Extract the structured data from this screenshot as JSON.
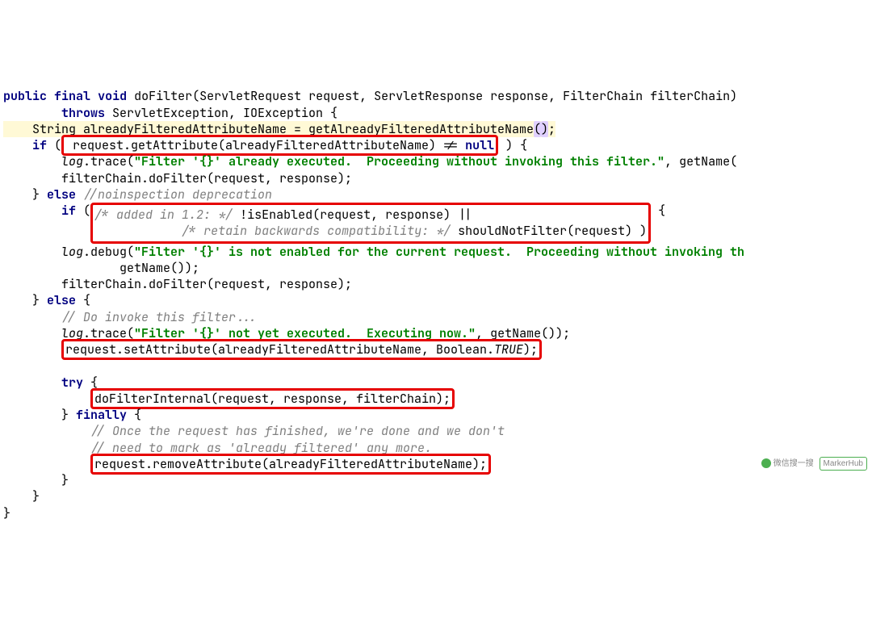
{
  "code": {
    "l01a": "public",
    "l01b": "final",
    "l01c": "void",
    "l01_sig": " doFilter(ServletRequest request, ServletResponse response, FilterChain filterChain)",
    "l02a": "throws",
    "l02_rest": " ServletException, IOException {",
    "l03_hl": "    String alreadyFilteredAttributeName = getAlreadyFilteredAttributeName",
    "l03_paren1": "(",
    "l03_paren2": ")",
    "l03_semi": ";",
    "l04_if": "if",
    "l04_pre": " (",
    "l04_box": " request.getAttribute(alreadyFilteredAttributeName) != ",
    "l04_null": "null",
    "l04_post": " ) {",
    "l05_ital": "log",
    "l05_mid": ".trace(",
    "l05_str": "\"Filter '{}' already executed.  Proceeding without invoking this filter.\"",
    "l05_end": ", getName(",
    "l06": "        filterChain.doFilter(request, response);",
    "l07_brace": "    } ",
    "l07_else": "else",
    "l07_sp": " ",
    "l07_comm": "//noinspection deprecation",
    "l08_if": "if",
    "l08_pre": " (",
    "l08_comm1": "/* added in 1.2: */",
    "l08_mid": " !isEnabled(request, response) ||",
    "l09_comm": "/* retain backwards compatibility: */",
    "l09_mid": " shouldNotFilter(request) )",
    "l09_post": " {",
    "l10_log": "log",
    "l10_mid": ".debug(",
    "l10_str": "\"Filter '{}' is not enabled for the current request.  Proceeding without invoking th",
    "l11_a": "                getName());",
    "l12": "        filterChain.doFilter(request, response);",
    "l13_brace": "    } ",
    "l13_else": "else",
    "l13_post": " {",
    "l14_comm": "// Do invoke this filter...",
    "l15_log": "log",
    "l15_mid": ".trace(",
    "l15_str": "\"Filter '{}' not yet executed.  Executing now.\"",
    "l15_end": ", getName());",
    "l16_box": "request.setAttribute(alreadyFilteredAttributeName, Boolean.",
    "l16_true": "TRUE",
    "l16_end": ");",
    "l17_try": "try",
    "l17_post": " {",
    "l18_box": "doFilterInternal(request, response, filterChain);",
    "l19_brace": "        } ",
    "l19_fin": "finally",
    "l19_post": " {",
    "l20_comm": "// Once the request has finished, we're done and we don't",
    "l21_comm": "// need to mark as 'already filtered' any more.",
    "l22_box": "request.removeAttribute(alreadyFilteredAttributeName);",
    "l23": "        }",
    "l24": "    }",
    "l25": "}"
  },
  "watermark": {
    "text1": "微信搜一搜",
    "text2": "MarkerHub"
  }
}
